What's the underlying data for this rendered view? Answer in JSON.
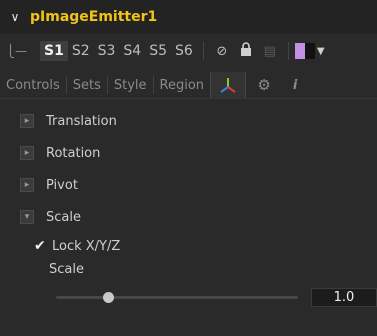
{
  "title": {
    "text": "pImageEmitter1",
    "color": "#f0c419"
  },
  "toolbar": {
    "slots": [
      "S1",
      "S2",
      "S3",
      "S4",
      "S5",
      "S6"
    ],
    "active_slot": "S1",
    "swatch_colors": [
      "#c38fe6",
      "#111111"
    ]
  },
  "tabs": [
    "Controls",
    "Sets",
    "Style",
    "Region"
  ],
  "active_tab": "3d-transform",
  "sections": [
    {
      "label": "Translation",
      "expanded": false
    },
    {
      "label": "Rotation",
      "expanded": false
    },
    {
      "label": "Pivot",
      "expanded": false
    },
    {
      "label": "Scale",
      "expanded": true
    }
  ],
  "lock": {
    "label": "Lock X/Y/Z",
    "checked": true
  },
  "scale": {
    "label": "Scale",
    "value": "1.0"
  },
  "icons": {
    "expand": "chevron-down-icon",
    "pin": "pin-icon",
    "disable": "disable-icon",
    "lock": "lock-icon",
    "gear": "gear-icon",
    "info": "info-icon"
  }
}
